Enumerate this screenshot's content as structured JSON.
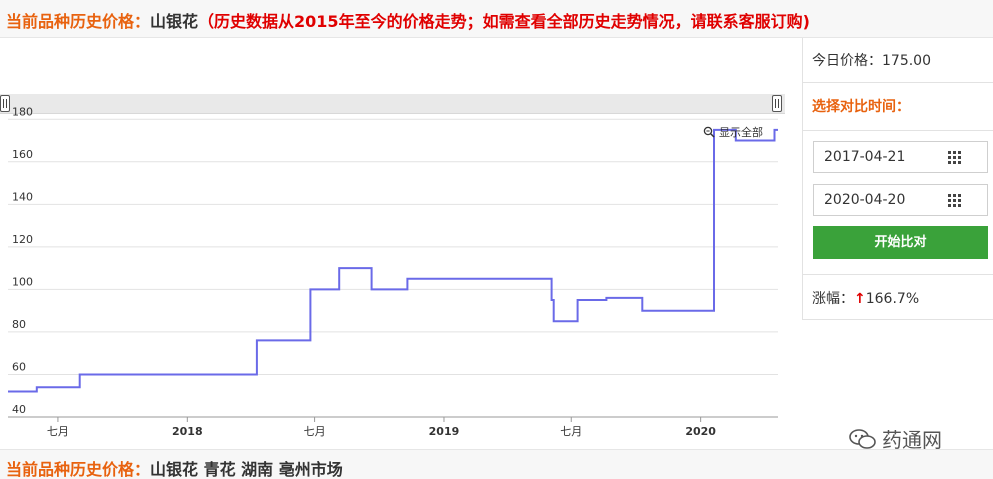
{
  "header": {
    "label": "当前品种历史价格：",
    "product": "山银花",
    "note": "（历史数据从2015年至今的价格走势；如需查看全部历史走势情况，请联系客服订购)"
  },
  "chart_data": {
    "type": "line",
    "ylim": [
      40,
      190
    ],
    "yticks": [
      40,
      60,
      80,
      100,
      120,
      140,
      160,
      180
    ],
    "xlim": [
      "2017-04-21",
      "2020-04-20"
    ],
    "xticks": [
      {
        "date": "2017-07-01",
        "label": "七月",
        "bold": false
      },
      {
        "date": "2018-01-01",
        "label": "2018",
        "bold": true
      },
      {
        "date": "2018-07-01",
        "label": "七月",
        "bold": false
      },
      {
        "date": "2019-01-01",
        "label": "2019",
        "bold": true
      },
      {
        "date": "2019-07-01",
        "label": "七月",
        "bold": false
      },
      {
        "date": "2020-01-01",
        "label": "2020",
        "bold": true
      }
    ],
    "step": true,
    "series": [
      {
        "color": "#6a6ae8",
        "points": [
          [
            "2017-04-21",
            52
          ],
          [
            "2017-06-01",
            54
          ],
          [
            "2017-08-01",
            60
          ],
          [
            "2018-04-10",
            76
          ],
          [
            "2018-06-25",
            100
          ],
          [
            "2018-08-05",
            110
          ],
          [
            "2018-09-20",
            100
          ],
          [
            "2018-11-10",
            105
          ],
          [
            "2019-06-03",
            95
          ],
          [
            "2019-06-06",
            85
          ],
          [
            "2019-07-10",
            95
          ],
          [
            "2019-08-20",
            96
          ],
          [
            "2019-10-10",
            90
          ],
          [
            "2020-01-20",
            175
          ],
          [
            "2020-02-20",
            170
          ],
          [
            "2020-04-15",
            175
          ],
          [
            "2020-04-20",
            175
          ]
        ]
      }
    ]
  },
  "zoom": {
    "label": "显示全部"
  },
  "panel": {
    "today_label": "今日价格：",
    "today_value": "175.00",
    "select_label": "选择对比时间：",
    "date_from": "2017-04-21",
    "date_to": "2020-04-20",
    "compare_button": "开始比对",
    "change_label": "涨幅：",
    "change_arrow": "↑",
    "change_value": "166.7%"
  },
  "footer": {
    "label": "当前品种历史价格：",
    "product_info": "山银花 青花 湖南 亳州市场"
  },
  "watermark": {
    "text": "药通网"
  },
  "colors": {
    "accent": "#e8620f",
    "alert": "#e00000",
    "button": "#3aa23a",
    "line": "#6a6ae8"
  }
}
